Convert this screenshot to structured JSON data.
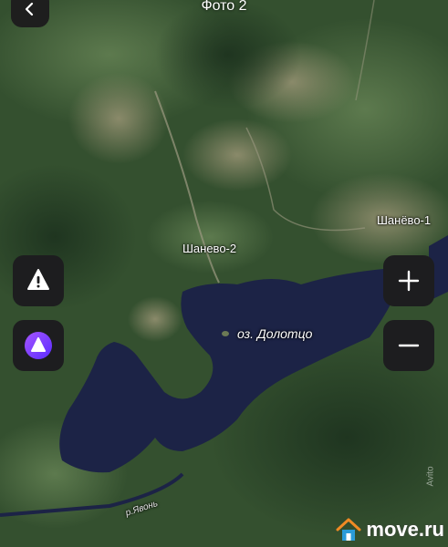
{
  "header": {
    "title": "Фото 2"
  },
  "map_labels": {
    "village_1": "Шанёво-1",
    "village_2": "Шанево-2",
    "lake": "оз. Долотцо",
    "river": "р.Явонь"
  },
  "controls": {
    "zoom_in_label": "+",
    "zoom_out_label": "−"
  },
  "watermark": {
    "text": "move.ru",
    "avito": "Avito"
  },
  "colors": {
    "lake": "#1c2346",
    "forest": "#2f4a2c",
    "button_bg": "#1d1d1f",
    "alice_purple": "#7b3cff",
    "move_orange": "#f08a24"
  },
  "icons": [
    "back-arrow-icon",
    "warning-icon",
    "alice-assistant-icon",
    "plus-icon",
    "minus-icon",
    "house-logo-icon"
  ]
}
